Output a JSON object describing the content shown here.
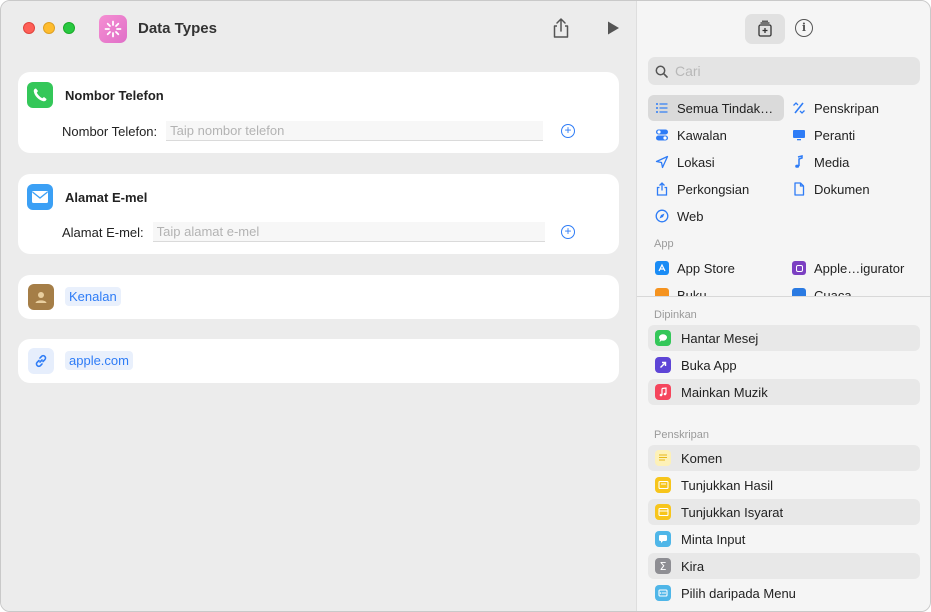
{
  "window": {
    "title": "Data Types"
  },
  "colors": {
    "accent": "#2e7cf6",
    "app_icon": "#e773cc",
    "phone_green": "#34c759",
    "mail_blue": "#3ba0f5"
  },
  "cards": {
    "phone": {
      "title": "Nombor Telefon",
      "label": "Nombor Telefon:",
      "placeholder": "Taip nombor telefon",
      "icon": "phone-icon"
    },
    "email": {
      "title": "Alamat E-mel",
      "label": "Alamat E-mel:",
      "placeholder": "Taip alamat e-mel",
      "icon": "envelope-icon"
    },
    "contacts": {
      "token": "Kenalan",
      "icon": "contacts-icon"
    },
    "url": {
      "token": "apple.com",
      "icon": "link-icon"
    }
  },
  "sidebar": {
    "search_placeholder": "Cari",
    "categories": [
      {
        "label": "Semua Tindak…",
        "icon": "list-icon"
      },
      {
        "label": "Penskripan",
        "icon": "scripting-icon"
      },
      {
        "label": "Kawalan",
        "icon": "toggle-icon"
      },
      {
        "label": "Peranti",
        "icon": "display-icon"
      },
      {
        "label": "Lokasi",
        "icon": "location-arrow-icon"
      },
      {
        "label": "Media",
        "icon": "music-note-icon"
      },
      {
        "label": "Perkongsian",
        "icon": "share-icon"
      },
      {
        "label": "Dokumen",
        "icon": "document-icon"
      },
      {
        "label": "Web",
        "icon": "compass-icon"
      }
    ],
    "app_section": "App",
    "apps": [
      {
        "label": "App Store",
        "icon": "app-store-icon"
      },
      {
        "label": "Apple…igurator",
        "icon": "configurator-icon"
      },
      {
        "label": "Buku",
        "icon": "books-icon"
      },
      {
        "label": "Cuaca",
        "icon": "weather-icon"
      }
    ],
    "pinned_section": "Dipinkan",
    "pinned": [
      {
        "label": "Hantar Mesej",
        "icon": "messages-icon"
      },
      {
        "label": "Buka App",
        "icon": "open-app-icon"
      },
      {
        "label": "Mainkan Muzik",
        "icon": "music-icon"
      }
    ],
    "scripting_section": "Penskripan",
    "scripting": [
      {
        "label": "Komen",
        "icon": "comment-icon"
      },
      {
        "label": "Tunjukkan Hasil",
        "icon": "show-result-icon"
      },
      {
        "label": "Tunjukkan Isyarat",
        "icon": "alert-icon"
      },
      {
        "label": "Minta Input",
        "icon": "ask-input-icon"
      },
      {
        "label": "Kira",
        "icon": "sigma-icon"
      },
      {
        "label": "Pilih daripada Menu",
        "icon": "menu-icon"
      }
    ]
  }
}
